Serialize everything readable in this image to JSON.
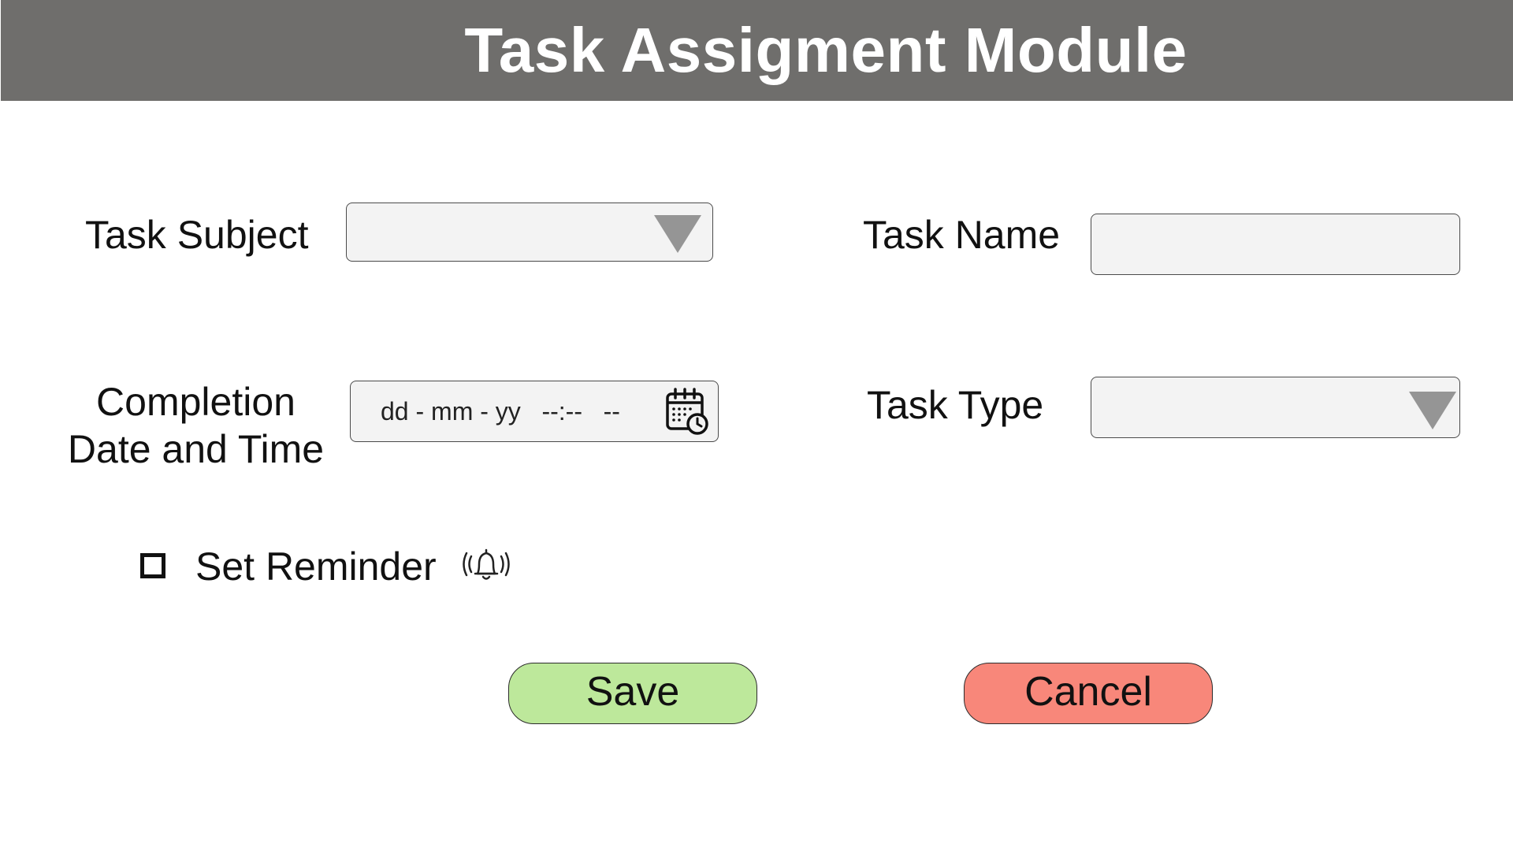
{
  "header": {
    "title": "Task Assigment Module"
  },
  "form": {
    "task_subject": {
      "label": "Task Subject",
      "value": ""
    },
    "task_name": {
      "label": "Task Name",
      "value": ""
    },
    "completion": {
      "label_line1": "Completion",
      "label_line2": "Date and Time",
      "placeholder": "dd - mm - yy   --:--   --"
    },
    "task_type": {
      "label": "Task Type",
      "value": ""
    },
    "reminder": {
      "label": "Set Reminder",
      "checked": false
    }
  },
  "actions": {
    "save_label": "Save",
    "cancel_label": "Cancel"
  },
  "icons": {
    "dropdown": "chevron-down-icon",
    "calendar": "calendar-clock-icon",
    "bell": "bell-ringing-icon"
  },
  "colors": {
    "header_bg": "#6f6e6c",
    "field_bg": "#f3f3f3",
    "save_bg": "#bde89b",
    "cancel_bg": "#f8877a",
    "arrow": "#959595"
  }
}
